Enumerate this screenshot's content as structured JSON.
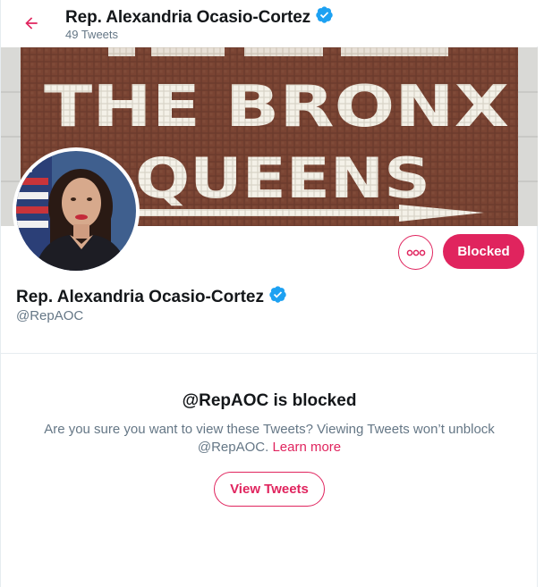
{
  "header": {
    "name": "Rep. Alexandria Ocasio-Cortez",
    "tweet_count": "49 Tweets"
  },
  "banner": {
    "line1": "THE BRONX",
    "line2": "QUEENS",
    "tile_color": "#6d3b2e",
    "letter_color": "#f2efe6"
  },
  "profile": {
    "name": "Rep. Alexandria Ocasio-Cortez",
    "handle": "@RepAOC"
  },
  "actions": {
    "more_icon": "more-icon",
    "blocked_label": "Blocked"
  },
  "blocked_notice": {
    "title": "@RepAOC is blocked",
    "text": "Are you sure you want to view these Tweets? Viewing Tweets won’t unblock @RepAOC.",
    "link": "Learn more",
    "button": "View Tweets"
  },
  "colors": {
    "accent": "#e0245e",
    "verified": "#1da1f2",
    "muted": "#657786"
  }
}
